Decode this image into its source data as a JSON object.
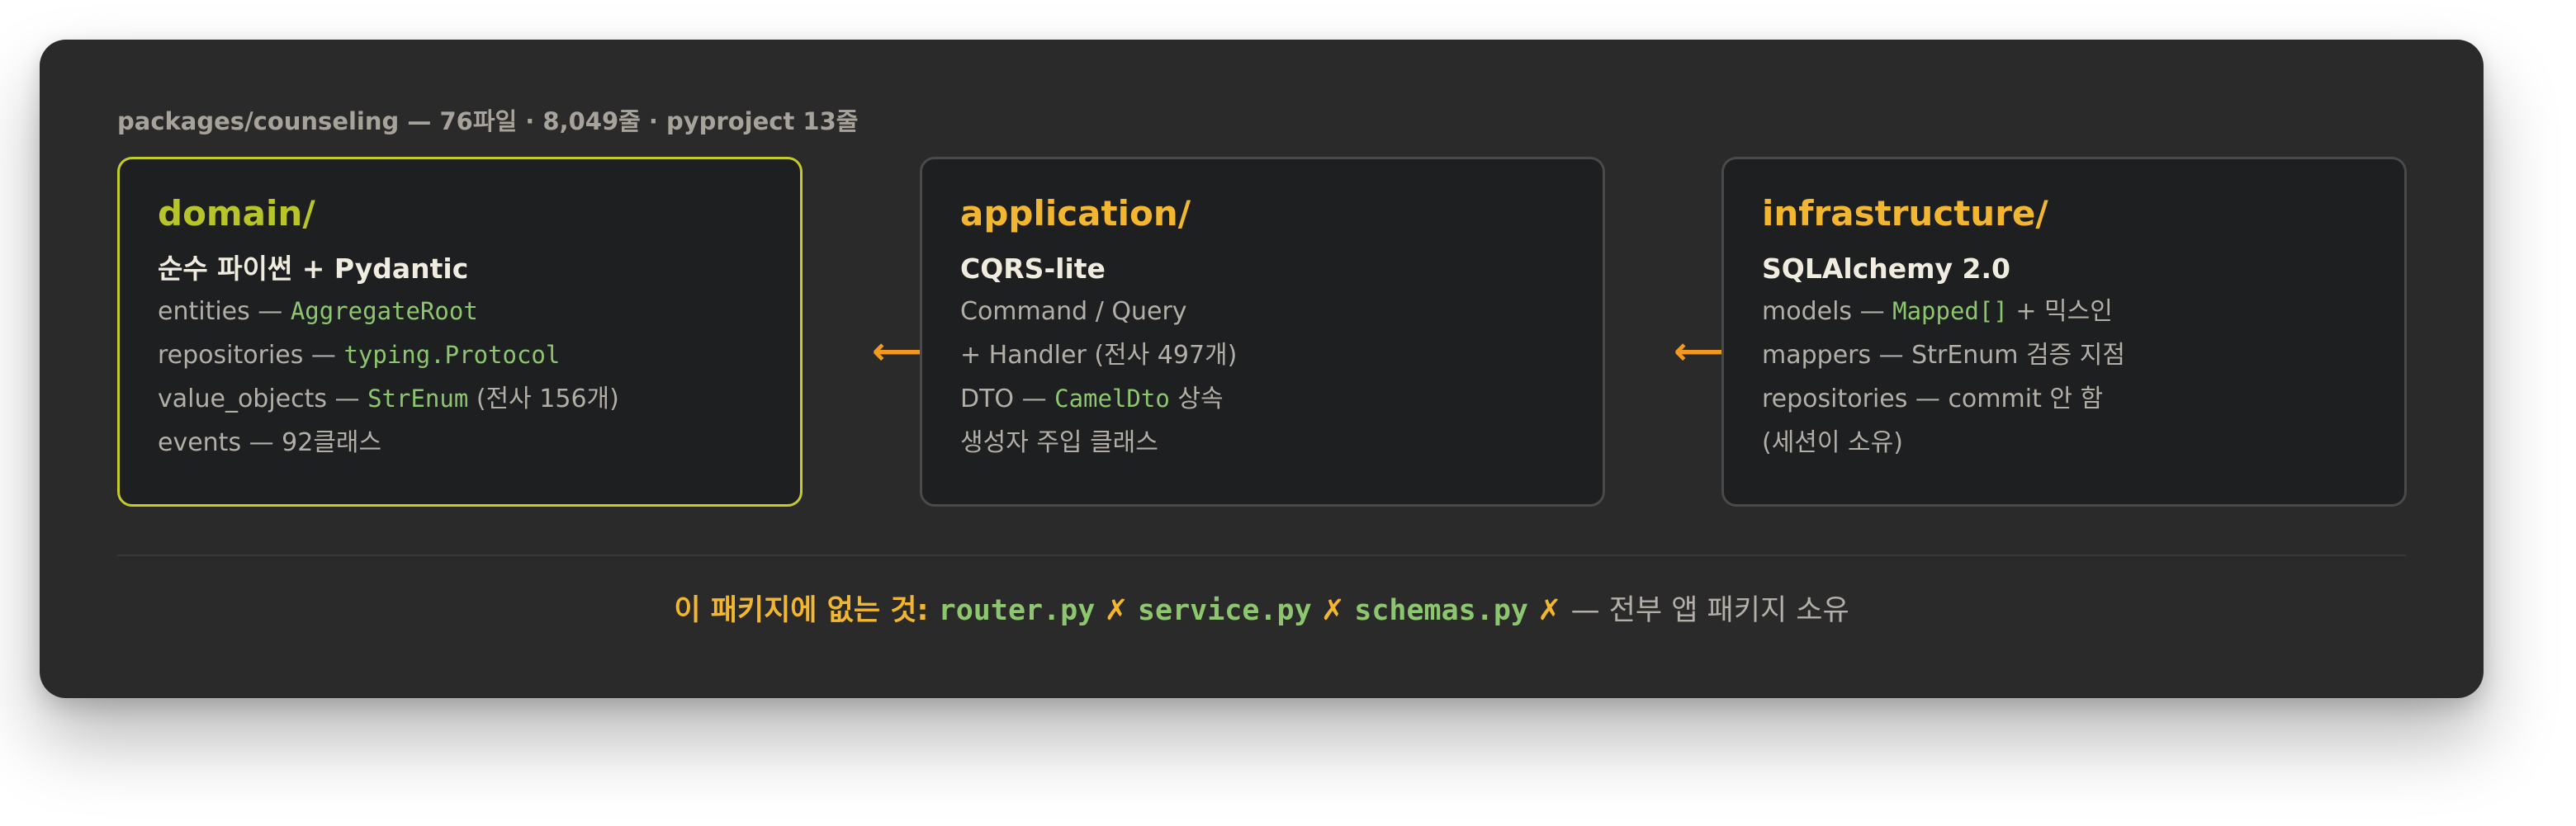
{
  "caption": "packages/counseling — 76파일 · 8,049줄 · pyproject 13줄",
  "cards": [
    {
      "title": "domain/",
      "subtitle": "순수 파이썬 + Pydantic",
      "lines": [
        {
          "pre": "entities — ",
          "code": "AggregateRoot",
          "post": ""
        },
        {
          "pre": "repositories — ",
          "code": "typing.Protocol",
          "post": ""
        },
        {
          "pre": "value_objects — ",
          "code": "StrEnum",
          "post": " (전사 156개)"
        },
        {
          "pre": "events — 92클래스",
          "code": "",
          "post": ""
        }
      ]
    },
    {
      "title": "application/",
      "subtitle": "CQRS-lite",
      "lines": [
        {
          "pre": "Command / Query",
          "code": "",
          "post": ""
        },
        {
          "pre": "+ Handler (전사 497개)",
          "code": "",
          "post": ""
        },
        {
          "pre": "DTO — ",
          "code": "CamelDto",
          "post": " 상속"
        },
        {
          "pre": "생성자 주입 클래스",
          "code": "",
          "post": ""
        }
      ]
    },
    {
      "title": "infrastructure/",
      "subtitle": "SQLAlchemy 2.0",
      "lines": [
        {
          "pre": "models — ",
          "code": "Mapped[]",
          "post": " + 믹스인"
        },
        {
          "pre": "mappers — StrEnum 검증 지점",
          "code": "",
          "post": ""
        },
        {
          "pre": "repositories — commit 안 함",
          "code": "",
          "post": ""
        },
        {
          "pre": "(세션이 소유)",
          "code": "",
          "post": ""
        }
      ]
    }
  ],
  "arrows": [
    "⟵",
    "⟵"
  ],
  "footer": {
    "lead": "이 패키지에 없는 것: ",
    "items": [
      {
        "file": "router.py",
        "mark": "✗"
      },
      {
        "file": "service.py",
        "mark": "✗"
      },
      {
        "file": "schemas.py",
        "mark": "✗"
      }
    ],
    "tail": " — 전부 앱 패키지 소유"
  },
  "colors": {
    "panel": "#2a2a2a",
    "card": "#1d1f20",
    "domain_accent": "#c4cc2c",
    "title_accent": "#f2b630",
    "arrow": "#f39a1e",
    "code": "#8dc76d"
  }
}
